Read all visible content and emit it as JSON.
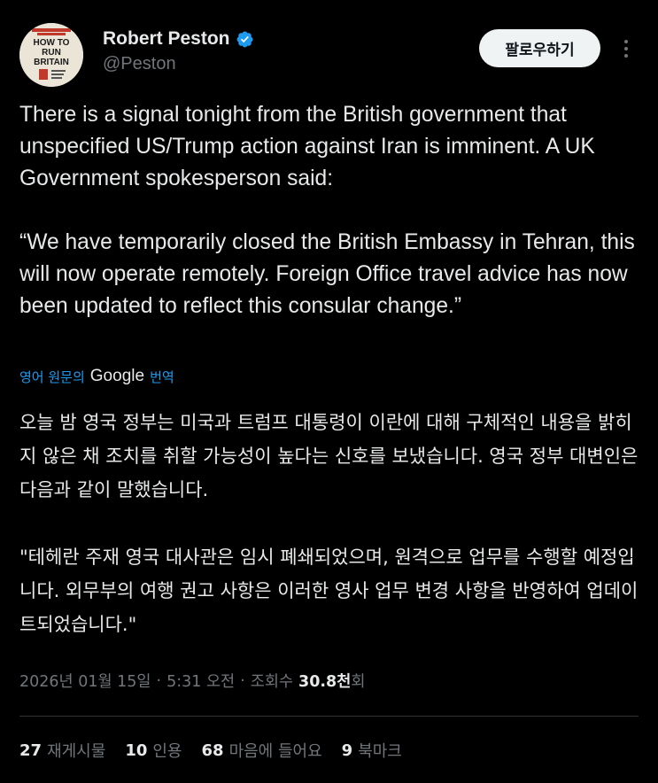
{
  "author": {
    "display_name": "Robert Peston",
    "handle": "@Peston",
    "avatar_book_title": "HOW TO RUN BRITAIN"
  },
  "follow_button": {
    "label": "팔로우하기"
  },
  "tweet": {
    "text": "There is a signal tonight from the British government that unspecified US/Trump action against Iran is imminent. A UK Government spokesperson said:\n\n“We have temporarily closed the British Embassy in Tehran, this will now operate remotely. Foreign Office travel advice has now been updated to reflect this consular change.”",
    "translate_prefix": "영어 원문의",
    "translate_brand": "Google",
    "translate_suffix": "번역",
    "translated_text": "오늘 밤 영국 정부는 미국과 트럼프 대통령이 이란에 대해 구체적인 내용을 밝히지 않은 채 조치를 취할 가능성이 높다는 신호를 보냈습니다. 영국 정부 대변인은 다음과 같이 말했습니다.\n\n\"테헤란 주재 영국 대사관은 임시 폐쇄되었으며, 원격으로 업무를 수행할 예정입니다. 외무부의 여행 권고 사항은 이러한 영사 업무 변경 사항을 반영하여 업데이트되었습니다.\""
  },
  "meta": {
    "date": "2026년 01월 15일",
    "sep1": "·",
    "time": "5:31 오전",
    "sep2": "·",
    "views_label": "조회수",
    "views_count": "30.8천",
    "views_suffix": "회"
  },
  "stats": [
    {
      "count": "27",
      "label": "재게시물"
    },
    {
      "count": "10",
      "label": "인용"
    },
    {
      "count": "68",
      "label": "마음에 들어요"
    },
    {
      "count": "9",
      "label": "북마크"
    }
  ],
  "colors": {
    "background": "#000000",
    "text": "#e7e9ea",
    "muted": "#71767b",
    "accent": "#1d9bf0",
    "verified": "#1d9bf0",
    "divider": "#2f3336"
  },
  "icons": {
    "verified": "verified-badge-icon",
    "more": "more-options-icon"
  }
}
